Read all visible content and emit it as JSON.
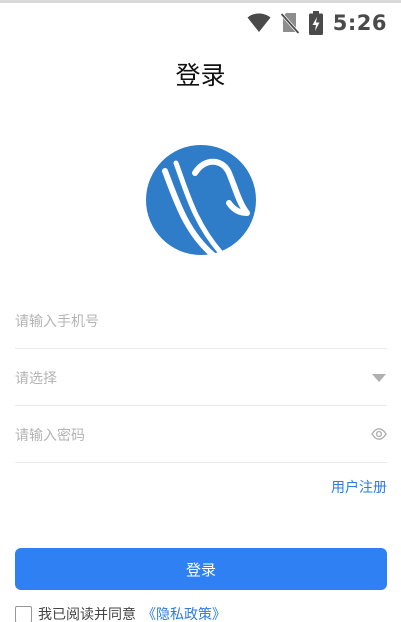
{
  "status_bar": {
    "time": "5:26",
    "icons": [
      "wifi-icon",
      "no-sim-icon",
      "battery-charging-icon"
    ]
  },
  "page": {
    "title": "登录"
  },
  "form": {
    "phone_placeholder": "请输入手机号",
    "select_placeholder": "请选择",
    "password_placeholder": "请输入密码",
    "register_link": "用户注册",
    "login_button": "登录"
  },
  "agreement": {
    "text": "我已阅读并同意",
    "policy_link": "《隐私政策》",
    "checked": false
  },
  "colors": {
    "accent": "#2f80f3",
    "link": "#2e7be0",
    "logo": "#2f7cc9",
    "placeholder": "#b4b4b4"
  }
}
